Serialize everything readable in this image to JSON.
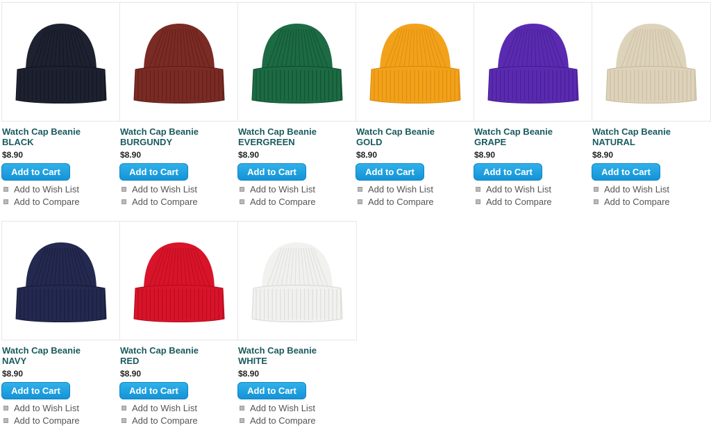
{
  "products": [
    {
      "name": "Watch Cap Beanie",
      "color": "BLACK",
      "price": "$8.90",
      "hex": "#1e2130",
      "rib": "#10131c"
    },
    {
      "name": "Watch Cap Beanie",
      "color": "BURGUNDY",
      "price": "$8.90",
      "hex": "#7a2b24",
      "rib": "#5a1b16"
    },
    {
      "name": "Watch Cap Beanie",
      "color": "EVERGREEN",
      "price": "$8.90",
      "hex": "#1c6b44",
      "rib": "#104a2d"
    },
    {
      "name": "Watch Cap Beanie",
      "color": "GOLD",
      "price": "$8.90",
      "hex": "#f2a21a",
      "rib": "#d8850a"
    },
    {
      "name": "Watch Cap Beanie",
      "color": "GRAPE",
      "price": "$8.90",
      "hex": "#5a2bb0",
      "rib": "#421b8c"
    },
    {
      "name": "Watch Cap Beanie",
      "color": "NATURAL",
      "price": "$8.90",
      "hex": "#ddd3bb",
      "rib": "#c4b899"
    },
    {
      "name": "Watch Cap Beanie",
      "color": "NAVY",
      "price": "$8.90",
      "hex": "#24294f",
      "rib": "#161a38"
    },
    {
      "name": "Watch Cap Beanie",
      "color": "RED",
      "price": "$8.90",
      "hex": "#d8142a",
      "rib": "#b00a1c"
    },
    {
      "name": "Watch Cap Beanie",
      "color": "WHITE",
      "price": "$8.90",
      "hex": "#f1f1ef",
      "rib": "#d6d6d2"
    }
  ],
  "actions": {
    "add_to_cart": "Add to Cart",
    "wish_list": "Add to Wish List",
    "compare": "Add to Compare"
  }
}
